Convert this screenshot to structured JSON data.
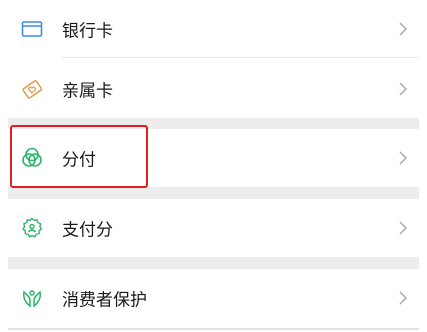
{
  "items": [
    {
      "label": "银行卡",
      "icon": "bank-card-icon"
    },
    {
      "label": "亲属卡",
      "icon": "family-card-icon"
    },
    {
      "label": "分付",
      "icon": "fenfu-icon"
    },
    {
      "label": "支付分",
      "icon": "payment-score-icon"
    },
    {
      "label": "消费者保护",
      "icon": "consumer-protection-icon"
    }
  ],
  "colors": {
    "accent_green": "#2bb56a",
    "bank_card_blue": "#3a8ee6",
    "family_card_orange": "#e0a04f",
    "highlight_red": "#e02020",
    "section_gap": "#ededed"
  }
}
